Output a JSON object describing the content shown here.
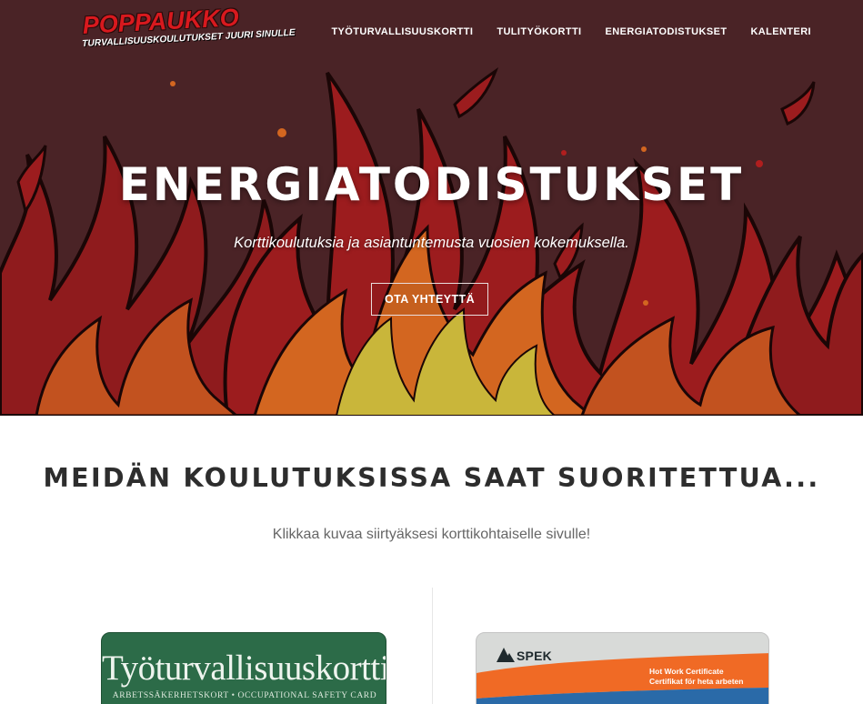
{
  "brand": {
    "name": "POPPAUKKO",
    "tagline": "TURVALLISUUSKOULUTUKSET JUURI SINULLE",
    "colors": {
      "logo_red": "#d8191e",
      "hero_bg": "#4a2326",
      "flame_red": "#b01e1e",
      "flame_orange": "#d9661f",
      "flame_yellow": "#c9b63a"
    }
  },
  "nav": {
    "items": [
      {
        "label": "TYÖTURVALLISUUSKORTTI"
      },
      {
        "label": "TULITYÖKORTTI"
      },
      {
        "label": "ENERGIATODISTUKSET"
      },
      {
        "label": "KALENTERI"
      }
    ]
  },
  "hero": {
    "title": "ENERGIATODISTUKSET",
    "subtitle": "Korttikoulutuksia ja asiantuntemusta vuosien kokemuksella.",
    "cta_label": "OTA YHTEYTTÄ"
  },
  "section": {
    "title": "MEIDÄN KOULUTUKSISSA SAAT SUORITETTUA...",
    "subtitle": "Klikkaa kuvaa siirtyäksesi korttikohtaiselle sivulle!"
  },
  "cards": {
    "green": {
      "title": "Työturvallisuuskortti",
      "subtitle": "ARBETSSÄKERHETSKORT • OCCUPATIONAL SAFETY CARD",
      "color": "#2c6b48"
    },
    "spek": {
      "logo_text": "SPEK",
      "line1": "Hot Work Certificate",
      "line2": "Certifikat för heta arbeten",
      "band_orange": "#f06a25",
      "band_blue": "#2a6aa8"
    }
  }
}
